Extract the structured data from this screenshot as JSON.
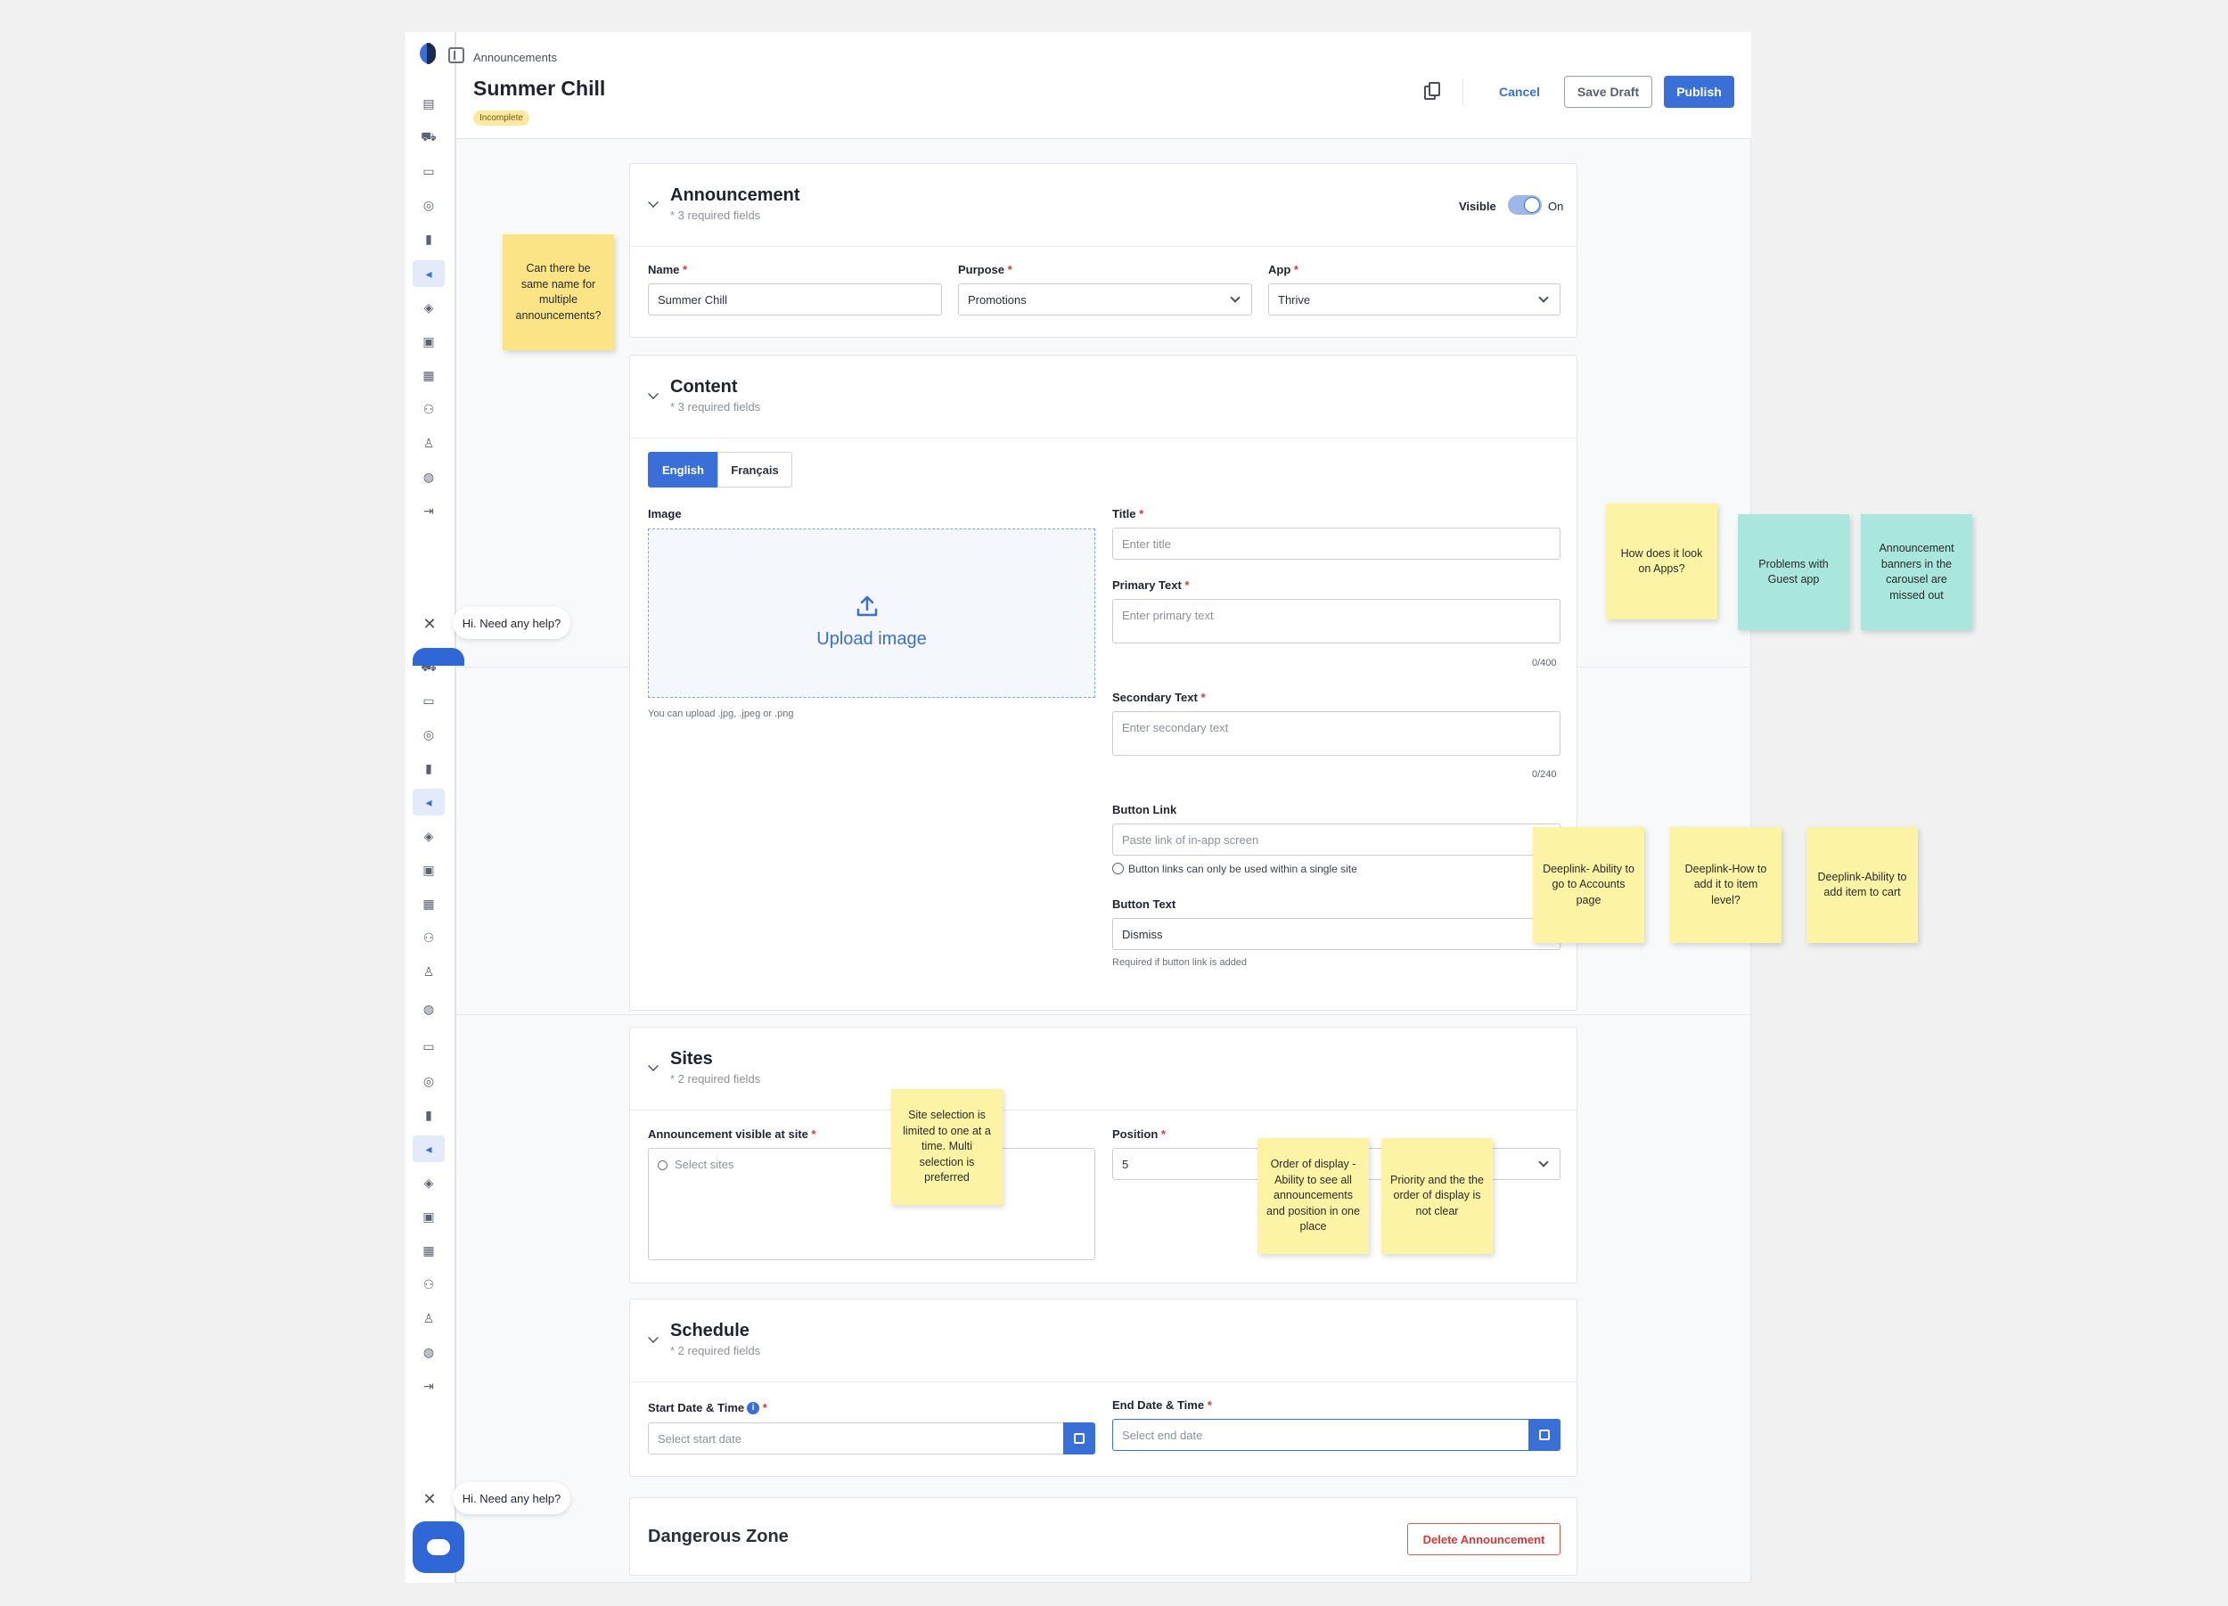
{
  "header": {
    "breadcrumb": "Announcements",
    "title": "Summer Chill",
    "status_badge": "Incomplete",
    "cancel_label": "Cancel",
    "save_draft_label": "Save Draft",
    "publish_label": "Publish"
  },
  "announcement": {
    "title": "Announcement",
    "subtitle": "* 3 required fields",
    "visible_label": "Visible",
    "visible_state": "On",
    "name_label": "Name",
    "name_value": "Summer Chill",
    "purpose_label": "Purpose",
    "purpose_value": "Promotions",
    "app_label": "App",
    "app_value": "Thrive"
  },
  "content": {
    "title": "Content",
    "subtitle": "* 3 required fields",
    "tab_english": "English",
    "tab_french": "Français",
    "image_label": "Image",
    "upload_text": "Upload image",
    "upload_hint": "You can upload .jpg, .jpeg or .png",
    "title_label": "Title",
    "title_placeholder": "Enter title",
    "primary_label": "Primary Text",
    "primary_placeholder": "Enter primary text",
    "primary_counter": "0/400",
    "secondary_label": "Secondary Text",
    "secondary_placeholder": "Enter secondary text",
    "secondary_counter": "0/240",
    "button_link_label": "Button Link",
    "button_link_placeholder": "Paste link of in-app screen",
    "button_link_hint": "Button links can only be used within a single site",
    "button_text_label": "Button Text",
    "button_text_value": "Dismiss",
    "button_text_hint": "Required if button link is added"
  },
  "sites": {
    "title": "Sites",
    "subtitle": "* 2 required fields",
    "site_label": "Announcement visible at site",
    "site_placeholder": "Select sites",
    "position_label": "Position",
    "position_value": "5"
  },
  "schedule": {
    "title": "Schedule",
    "subtitle": "* 2 required fields",
    "start_label": "Start Date & Time",
    "start_placeholder": "Select start date",
    "end_label": "End Date & Time",
    "end_placeholder": "Select end date"
  },
  "danger": {
    "title": "Dangerous Zone",
    "delete_label": "Delete Announcement"
  },
  "help": {
    "bubble_text": "Hi. Need any help?"
  },
  "stickies": {
    "same_name": "Can there be same name for multiple announcements?",
    "look_apps": "How does it look on Apps?",
    "guest_app": "Problems with Guest app",
    "carousel": "Announcement banners in the carousel are missed out",
    "deeplink_accounts": "Deeplink- Ability to go to Accounts page",
    "deeplink_item": "Deeplink-How to add it to item level?",
    "deeplink_cart": "Deeplink-Ability to add item to cart",
    "site_selection": "Site selection is limited to one at a time. Multi selection is preferred",
    "order_display": "Order of display - Ability to see all announcements and position in one place",
    "priority": "Priority and the the order of display is not clear"
  },
  "colors": {
    "accent": "#3a6fd8",
    "sticky_yellow": "#fdf3a4",
    "sticky_teal": "#a9e6dd",
    "danger": "#d33a3a"
  }
}
